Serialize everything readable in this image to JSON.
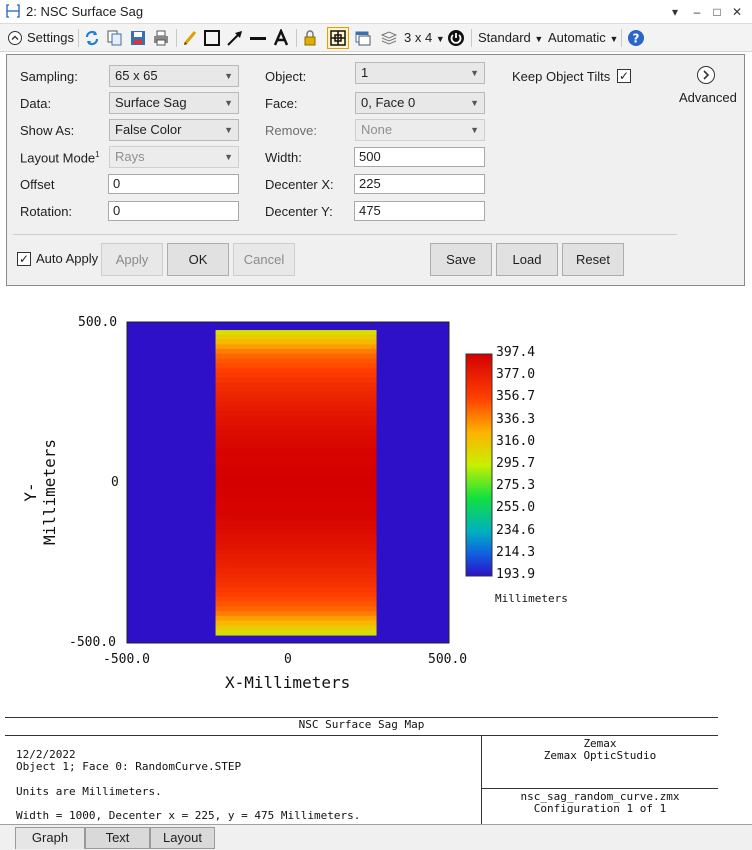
{
  "window": {
    "title": "2: NSC Surface Sag",
    "buttons": [
      "▾",
      "–",
      "□",
      "✕"
    ]
  },
  "toolbar": {
    "settings_label": "Settings",
    "grid_label": "3 x 4",
    "standard_label": "Standard",
    "automatic_label": "Automatic"
  },
  "settings": {
    "sampling": {
      "label": "Sampling:",
      "value": "65 x 65"
    },
    "data": {
      "label": "Data:",
      "value": "Surface Sag"
    },
    "show_as": {
      "label": "Show As:",
      "value": "False Color"
    },
    "layout_mode": {
      "label": "Layout Mode",
      "sup": "1",
      "value": "Rays"
    },
    "offset": {
      "label": "Offset",
      "value": "0"
    },
    "rotation": {
      "label": "Rotation:",
      "value": "0"
    },
    "object": {
      "label": "Object:",
      "value": "1"
    },
    "face": {
      "label": "Face:",
      "value": "0, Face 0"
    },
    "remove": {
      "label": "Remove:",
      "value": "None"
    },
    "width": {
      "label": "Width:",
      "value": "500"
    },
    "decenter_x": {
      "label": "Decenter X:",
      "value": "225"
    },
    "decenter_y": {
      "label": "Decenter Y:",
      "value": "475"
    },
    "keep_object_tilts": {
      "label": "Keep Object Tilts",
      "checked": "✓"
    },
    "advanced_label": "Advanced",
    "auto_apply": {
      "label": "Auto Apply",
      "checked": "✓"
    },
    "buttons": {
      "apply": "Apply",
      "ok": "OK",
      "cancel": "Cancel",
      "save": "Save",
      "load": "Load",
      "reset": "Reset"
    }
  },
  "chart_data": {
    "type": "heatmap",
    "title": "NSC Surface Sag Map",
    "xlabel": "X-Millimeters",
    "ylabel": "Y-Millimeters",
    "xlim": [
      -500.0,
      500.0
    ],
    "ylim": [
      -500.0,
      500.0
    ],
    "x_ticks": [
      "-500.0",
      "0",
      "500.0"
    ],
    "y_ticks": [
      "500.0",
      "0",
      "-500.0"
    ],
    "background_color": "#2d10c8",
    "sag_region": {
      "x": [
        -225,
        275
      ],
      "y": [
        -475,
        475
      ]
    },
    "sag_profile_along_y": {
      "y": [
        475,
        400,
        300,
        200,
        100,
        0,
        -100,
        -200,
        -300,
        -400,
        -475
      ],
      "sag": [
        300,
        345,
        370,
        385,
        395,
        397.4,
        395,
        385,
        370,
        345,
        300
      ]
    },
    "colorbar": {
      "unit": "Millimeters",
      "labels": [
        "397.4",
        "377.0",
        "356.7",
        "336.3",
        "316.0",
        "295.7",
        "275.3",
        "255.0",
        "234.6",
        "214.3",
        "193.9"
      ],
      "min": 193.9,
      "max": 397.4
    }
  },
  "footer": {
    "title": "NSC Surface Sag Map",
    "date": "12/2/2022",
    "object_line": "Object 1; Face 0: RandomCurve.STEP",
    "units_line": "Units are Millimeters.",
    "width_line": "Width = 1000, Decenter x = 225, y = 475 Millimeters.",
    "company": "Zemax",
    "product": "Zemax OpticStudio",
    "file": "nsc_sag_random_curve.zmx",
    "config": "Configuration 1 of 1"
  },
  "tabs": [
    "Graph",
    "Text",
    "Layout"
  ],
  "colors": {
    "accent": "#1f5fbf",
    "panel_bg": "#f0f0f0"
  }
}
